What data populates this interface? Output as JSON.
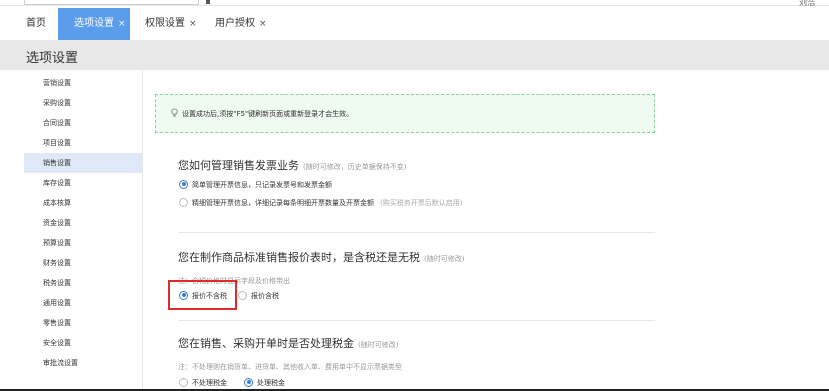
{
  "header": {
    "user_label": "刘浩"
  },
  "tabs": [
    {
      "label": "首页",
      "closable": ""
    },
    {
      "label": "选项设置",
      "closable": "×"
    },
    {
      "label": "权限设置",
      "closable": "×"
    },
    {
      "label": "用户授权",
      "closable": "×"
    }
  ],
  "page_title": "选项设置",
  "sidebar": {
    "items": [
      "营销设置",
      "采购设置",
      "合同设置",
      "项目设置",
      "销售设置",
      "库存设置",
      "成本核算",
      "资金设置",
      "预算设置",
      "财务设置",
      "税务设置",
      "通用设置",
      "零售设置",
      "安全设置",
      "审批流设置"
    ],
    "active": "销售设置"
  },
  "notice": "设置成功后,须按\"F5\"键刷新页面或重新登录才会生效。",
  "sections": {
    "invoice": {
      "title": "您如何管理销售发票业务",
      "hint": "(随时可修改，历史单据保持不变)",
      "options": [
        {
          "label": "简单管理开票信息，只记录发票号和发票金额",
          "extra": ""
        },
        {
          "label": "精细管理开票信息，详细记录每条明细开票数量及开票金额",
          "extra": "(购买税务开票后默认启用)"
        }
      ]
    },
    "price": {
      "title": "您在制作商品标准销售报价表时，是含税还是无税",
      "hint": "(随时可修改)",
      "note": "注：含税价格时显示字段及价格带出",
      "options": [
        "报价不含税",
        "报价含税"
      ]
    },
    "tax": {
      "title": "您在销售、采购开单时是否处理税金",
      "hint": "(随时可修改)",
      "note": "注：不处理则在销货单、进货单、其他收入单、费用单中不显示票据类型",
      "options": [
        "不处理税金",
        "处理税金"
      ]
    }
  },
  "colors": {
    "accent": "#5a9dea",
    "sidebar_active_bg": "#dfe8f6",
    "notice_border": "#8fd19e",
    "notice_bg": "#effaf1",
    "highlight_box": "#e02b2b"
  }
}
